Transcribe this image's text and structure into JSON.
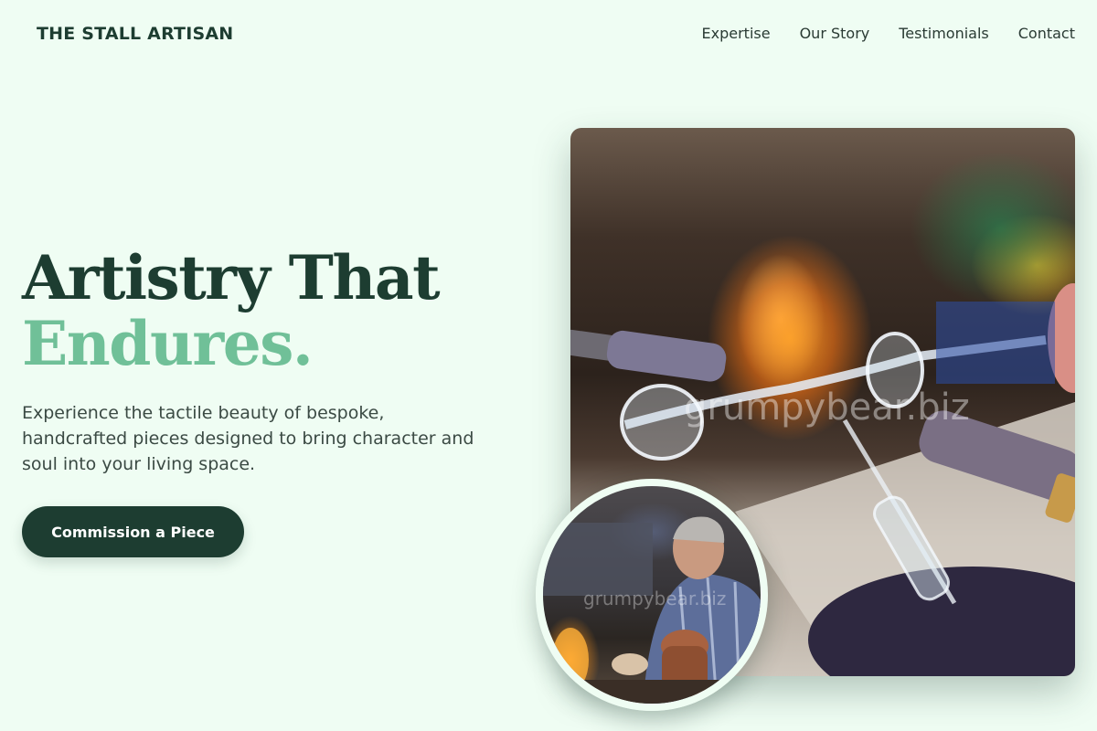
{
  "header": {
    "brand": "THE STALL ARTISAN",
    "nav": [
      "Expertise",
      "Our Story",
      "Testimonials",
      "Contact"
    ]
  },
  "hero": {
    "title_line1": "Artistry That",
    "title_line2": "Endures.",
    "description": "Experience the tactile beauty of bespoke, handcrafted pieces designed to bring character and soul into your living space.",
    "cta_label": "Commission a Piece"
  },
  "images": {
    "main_watermark": "grumpybear.biz",
    "circle_watermark": "grumpybear.biz"
  },
  "colors": {
    "background": "#effdf3",
    "primary": "#1d3d31",
    "accent": "#70c098"
  }
}
